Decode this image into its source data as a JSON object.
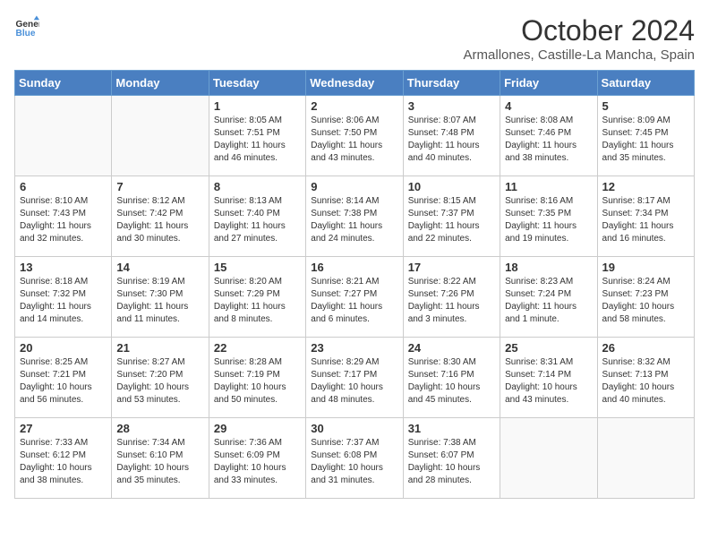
{
  "header": {
    "logo_line1": "General",
    "logo_line2": "Blue",
    "month_title": "October 2024",
    "location": "Armallones, Castille-La Mancha, Spain"
  },
  "weekdays": [
    "Sunday",
    "Monday",
    "Tuesday",
    "Wednesday",
    "Thursday",
    "Friday",
    "Saturday"
  ],
  "weeks": [
    [
      {
        "day": "",
        "empty": true
      },
      {
        "day": "",
        "empty": true
      },
      {
        "day": "1",
        "sunrise": "Sunrise: 8:05 AM",
        "sunset": "Sunset: 7:51 PM",
        "daylight": "Daylight: 11 hours and 46 minutes."
      },
      {
        "day": "2",
        "sunrise": "Sunrise: 8:06 AM",
        "sunset": "Sunset: 7:50 PM",
        "daylight": "Daylight: 11 hours and 43 minutes."
      },
      {
        "day": "3",
        "sunrise": "Sunrise: 8:07 AM",
        "sunset": "Sunset: 7:48 PM",
        "daylight": "Daylight: 11 hours and 40 minutes."
      },
      {
        "day": "4",
        "sunrise": "Sunrise: 8:08 AM",
        "sunset": "Sunset: 7:46 PM",
        "daylight": "Daylight: 11 hours and 38 minutes."
      },
      {
        "day": "5",
        "sunrise": "Sunrise: 8:09 AM",
        "sunset": "Sunset: 7:45 PM",
        "daylight": "Daylight: 11 hours and 35 minutes."
      }
    ],
    [
      {
        "day": "6",
        "sunrise": "Sunrise: 8:10 AM",
        "sunset": "Sunset: 7:43 PM",
        "daylight": "Daylight: 11 hours and 32 minutes."
      },
      {
        "day": "7",
        "sunrise": "Sunrise: 8:12 AM",
        "sunset": "Sunset: 7:42 PM",
        "daylight": "Daylight: 11 hours and 30 minutes."
      },
      {
        "day": "8",
        "sunrise": "Sunrise: 8:13 AM",
        "sunset": "Sunset: 7:40 PM",
        "daylight": "Daylight: 11 hours and 27 minutes."
      },
      {
        "day": "9",
        "sunrise": "Sunrise: 8:14 AM",
        "sunset": "Sunset: 7:38 PM",
        "daylight": "Daylight: 11 hours and 24 minutes."
      },
      {
        "day": "10",
        "sunrise": "Sunrise: 8:15 AM",
        "sunset": "Sunset: 7:37 PM",
        "daylight": "Daylight: 11 hours and 22 minutes."
      },
      {
        "day": "11",
        "sunrise": "Sunrise: 8:16 AM",
        "sunset": "Sunset: 7:35 PM",
        "daylight": "Daylight: 11 hours and 19 minutes."
      },
      {
        "day": "12",
        "sunrise": "Sunrise: 8:17 AM",
        "sunset": "Sunset: 7:34 PM",
        "daylight": "Daylight: 11 hours and 16 minutes."
      }
    ],
    [
      {
        "day": "13",
        "sunrise": "Sunrise: 8:18 AM",
        "sunset": "Sunset: 7:32 PM",
        "daylight": "Daylight: 11 hours and 14 minutes."
      },
      {
        "day": "14",
        "sunrise": "Sunrise: 8:19 AM",
        "sunset": "Sunset: 7:30 PM",
        "daylight": "Daylight: 11 hours and 11 minutes."
      },
      {
        "day": "15",
        "sunrise": "Sunrise: 8:20 AM",
        "sunset": "Sunset: 7:29 PM",
        "daylight": "Daylight: 11 hours and 8 minutes."
      },
      {
        "day": "16",
        "sunrise": "Sunrise: 8:21 AM",
        "sunset": "Sunset: 7:27 PM",
        "daylight": "Daylight: 11 hours and 6 minutes."
      },
      {
        "day": "17",
        "sunrise": "Sunrise: 8:22 AM",
        "sunset": "Sunset: 7:26 PM",
        "daylight": "Daylight: 11 hours and 3 minutes."
      },
      {
        "day": "18",
        "sunrise": "Sunrise: 8:23 AM",
        "sunset": "Sunset: 7:24 PM",
        "daylight": "Daylight: 11 hours and 1 minute."
      },
      {
        "day": "19",
        "sunrise": "Sunrise: 8:24 AM",
        "sunset": "Sunset: 7:23 PM",
        "daylight": "Daylight: 10 hours and 58 minutes."
      }
    ],
    [
      {
        "day": "20",
        "sunrise": "Sunrise: 8:25 AM",
        "sunset": "Sunset: 7:21 PM",
        "daylight": "Daylight: 10 hours and 56 minutes."
      },
      {
        "day": "21",
        "sunrise": "Sunrise: 8:27 AM",
        "sunset": "Sunset: 7:20 PM",
        "daylight": "Daylight: 10 hours and 53 minutes."
      },
      {
        "day": "22",
        "sunrise": "Sunrise: 8:28 AM",
        "sunset": "Sunset: 7:19 PM",
        "daylight": "Daylight: 10 hours and 50 minutes."
      },
      {
        "day": "23",
        "sunrise": "Sunrise: 8:29 AM",
        "sunset": "Sunset: 7:17 PM",
        "daylight": "Daylight: 10 hours and 48 minutes."
      },
      {
        "day": "24",
        "sunrise": "Sunrise: 8:30 AM",
        "sunset": "Sunset: 7:16 PM",
        "daylight": "Daylight: 10 hours and 45 minutes."
      },
      {
        "day": "25",
        "sunrise": "Sunrise: 8:31 AM",
        "sunset": "Sunset: 7:14 PM",
        "daylight": "Daylight: 10 hours and 43 minutes."
      },
      {
        "day": "26",
        "sunrise": "Sunrise: 8:32 AM",
        "sunset": "Sunset: 7:13 PM",
        "daylight": "Daylight: 10 hours and 40 minutes."
      }
    ],
    [
      {
        "day": "27",
        "sunrise": "Sunrise: 7:33 AM",
        "sunset": "Sunset: 6:12 PM",
        "daylight": "Daylight: 10 hours and 38 minutes."
      },
      {
        "day": "28",
        "sunrise": "Sunrise: 7:34 AM",
        "sunset": "Sunset: 6:10 PM",
        "daylight": "Daylight: 10 hours and 35 minutes."
      },
      {
        "day": "29",
        "sunrise": "Sunrise: 7:36 AM",
        "sunset": "Sunset: 6:09 PM",
        "daylight": "Daylight: 10 hours and 33 minutes."
      },
      {
        "day": "30",
        "sunrise": "Sunrise: 7:37 AM",
        "sunset": "Sunset: 6:08 PM",
        "daylight": "Daylight: 10 hours and 31 minutes."
      },
      {
        "day": "31",
        "sunrise": "Sunrise: 7:38 AM",
        "sunset": "Sunset: 6:07 PM",
        "daylight": "Daylight: 10 hours and 28 minutes."
      },
      {
        "day": "",
        "empty": true
      },
      {
        "day": "",
        "empty": true
      }
    ]
  ]
}
